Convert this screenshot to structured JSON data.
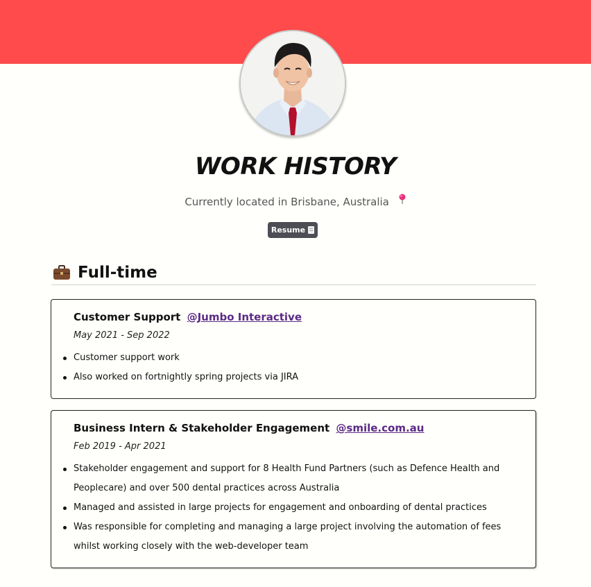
{
  "header": {
    "title": "WORK HISTORY",
    "location": "Currently located in Brisbane, Australia",
    "resume_label": "Resume"
  },
  "section": {
    "heading": "Full-time",
    "icon": "briefcase-icon"
  },
  "jobs": [
    {
      "role": "Customer Support",
      "company": "@Jumbo Interactive",
      "dates": "May 2021 - Sep 2022",
      "bullets": [
        "Customer support work",
        "Also worked on fortnightly spring projects via JIRA"
      ]
    },
    {
      "role": "Business Intern & Stakeholder Engagement",
      "company": "@smile.com.au",
      "dates": "Feb 2019 - Apr 2021",
      "bullets": [
        "Stakeholder engagement and support for 8 Health Fund Partners (such as Defence Health and Peoplecare) and over 500 dental practices across Australia",
        "Managed and assisted in large projects for engagement and onboarding of dental practices",
        "Was responsible for completing and managing a large project involving the automation of fees whilst working closely with the web-developer team"
      ]
    }
  ],
  "colors": {
    "banner": "#ff4b4b",
    "link": "#5b2a86",
    "button": "#4d4d55"
  }
}
